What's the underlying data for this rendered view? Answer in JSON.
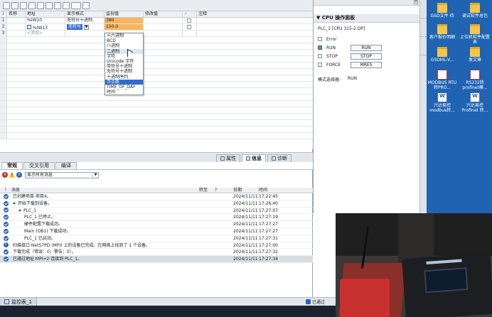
{
  "toolbar": {
    "icons": [
      "new-icon",
      "table-icon",
      "save-icon",
      "refresh-icon",
      "filter-icon",
      "monitor-icon",
      "step-icon",
      "modify-icon",
      "glasses-icon",
      "display-icon"
    ]
  },
  "watch_table": {
    "headers": [
      "i",
      "名称",
      "地址",
      "显示格式",
      "监视值",
      "修改值",
      "",
      "注释"
    ],
    "rows": [
      {
        "num": "1",
        "name": "",
        "address": "%IW10",
        "format": "无符号十进制",
        "monitor": "380",
        "modify": ""
      },
      {
        "num": "2",
        "name": "",
        "address": "%IW13",
        "format": "无符号",
        "monitor": "150.0",
        "modify": ""
      },
      {
        "num": "3",
        "name": "",
        "address": "<添加>",
        "format": "",
        "monitor": "",
        "modify": ""
      }
    ],
    "format_options": [
      "十六进制",
      "BCD",
      "八进制",
      "二进制",
      "字符",
      "Unicode 字符",
      "带符号十进制",
      "无符号十进制",
      "十进制序列",
      "浮点数",
      "TIME_OF_DAY",
      "时间"
    ]
  },
  "inspector_tabs": [
    "属性",
    "信息",
    "诊断"
  ],
  "sub_tabs": [
    "常规",
    "交叉引用",
    "编译"
  ],
  "filter": {
    "selected": "显示所有消息"
  },
  "messages": {
    "headers": [
      "!",
      "消息",
      "转至",
      "?",
      "日期",
      "时间"
    ],
    "rows": [
      {
        "icon": "ok",
        "indent": 1,
        "expander": false,
        "text": "已创建项目 项目4。",
        "date": "2024/11/11",
        "time": "17:22:45"
      },
      {
        "icon": "ok",
        "indent": 1,
        "expander": true,
        "text": "开始下载到设备。",
        "date": "2024/11/11",
        "time": "17:26:40"
      },
      {
        "icon": "ok",
        "indent": 2,
        "expander": true,
        "text": "PLC_1",
        "date": "2024/11/11",
        "time": "17:27:07"
      },
      {
        "icon": "ok",
        "indent": 3,
        "expander": false,
        "text": "PLC_1 已停止。",
        "date": "2024/11/11",
        "time": "17:27:19"
      },
      {
        "icon": "ok",
        "indent": 3,
        "expander": false,
        "text": "硬件配置下载成功。",
        "date": "2024/11/11",
        "time": "17:27:27"
      },
      {
        "icon": "ok",
        "indent": 3,
        "expander": false,
        "text": "Main (OB1) 下载成功。",
        "date": "2024/11/11",
        "time": "17:27:27"
      },
      {
        "icon": "ok",
        "indent": 3,
        "expander": false,
        "text": "PLC_1 已启动。",
        "date": "2024/11/11",
        "time": "17:27:31"
      },
      {
        "icon": "info",
        "indent": 1,
        "expander": false,
        "text": "扫描接口 NetS7PD (MPI) 上的设备已完成。在网络上找到了 1 个设备。",
        "date": "2024/11/11",
        "time": "17:27:00"
      },
      {
        "icon": "ok",
        "indent": 1,
        "expander": false,
        "text": "下载完成（错误：0；警告：0）。",
        "date": "2024/11/11",
        "time": "17:27:32"
      },
      {
        "icon": "ok",
        "indent": 1,
        "expander": false,
        "text": "已通过地址 MPI=2 连接到 PLC_1。",
        "date": "2024/11/11",
        "time": "17:27:34"
      }
    ]
  },
  "cpu_panel": {
    "title": "CPU 操作面板",
    "cpu_name": "PLC_1 [CPU 315-2 DP]",
    "leds": [
      {
        "label": "Error",
        "on": false,
        "button": ""
      },
      {
        "label": "RUN",
        "on": true,
        "button": "RUN"
      },
      {
        "label": "STOP",
        "on": false,
        "button": "STOP"
      },
      {
        "label": "FORCE",
        "on": false,
        "button": "MRES"
      }
    ],
    "mode_label": "模式选择器:",
    "mode_value": "RUN"
  },
  "desktop": {
    "icons": [
      {
        "label": "GSD文件 待",
        "kind": "folder"
      },
      {
        "label": "调试软件总包",
        "kind": "folder"
      },
      {
        "label": "客户报价明细",
        "kind": "folder"
      },
      {
        "label": "上位机软件配置表",
        "kind": "folder"
      },
      {
        "label": "GSDML-V...",
        "kind": "folder"
      },
      {
        "label": "发文章",
        "kind": "folder"
      },
      {
        "label": "MODBUS RTU转PRO...",
        "kind": "pdf"
      },
      {
        "label": "RS232转 profinet模...",
        "kind": "pdf"
      },
      {
        "label": "兴达易控 modbus转...",
        "kind": "doc"
      },
      {
        "label": "兴达易控 Profinet 转...",
        "kind": "doc"
      }
    ]
  },
  "statusbar": {
    "tab_label": "监控表_1",
    "right_text": "已通过"
  }
}
